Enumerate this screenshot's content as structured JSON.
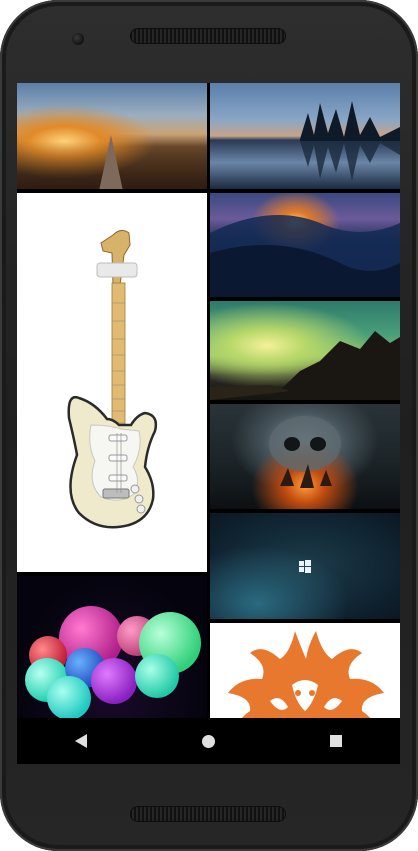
{
  "device": {
    "screen_bg": "#000000",
    "body_color": "#262626"
  },
  "gallery": {
    "tiles": [
      {
        "name": "road-sunset",
        "column": "left"
      },
      {
        "name": "guitar",
        "column": "left"
      },
      {
        "name": "glowing-orbs",
        "column": "left"
      },
      {
        "name": "lake-reflection",
        "column": "right"
      },
      {
        "name": "wave-sunset",
        "column": "right"
      },
      {
        "name": "green-sky-landscape",
        "column": "right"
      },
      {
        "name": "skull-clouds-ships",
        "column": "right"
      },
      {
        "name": "windows-logo-wallpaper",
        "column": "right"
      },
      {
        "name": "orange-fox-art",
        "column": "right"
      }
    ]
  },
  "navigation": {
    "back_icon": "triangle-left",
    "home_icon": "circle",
    "recents_icon": "square",
    "icon_color": "#e0e0e0"
  }
}
